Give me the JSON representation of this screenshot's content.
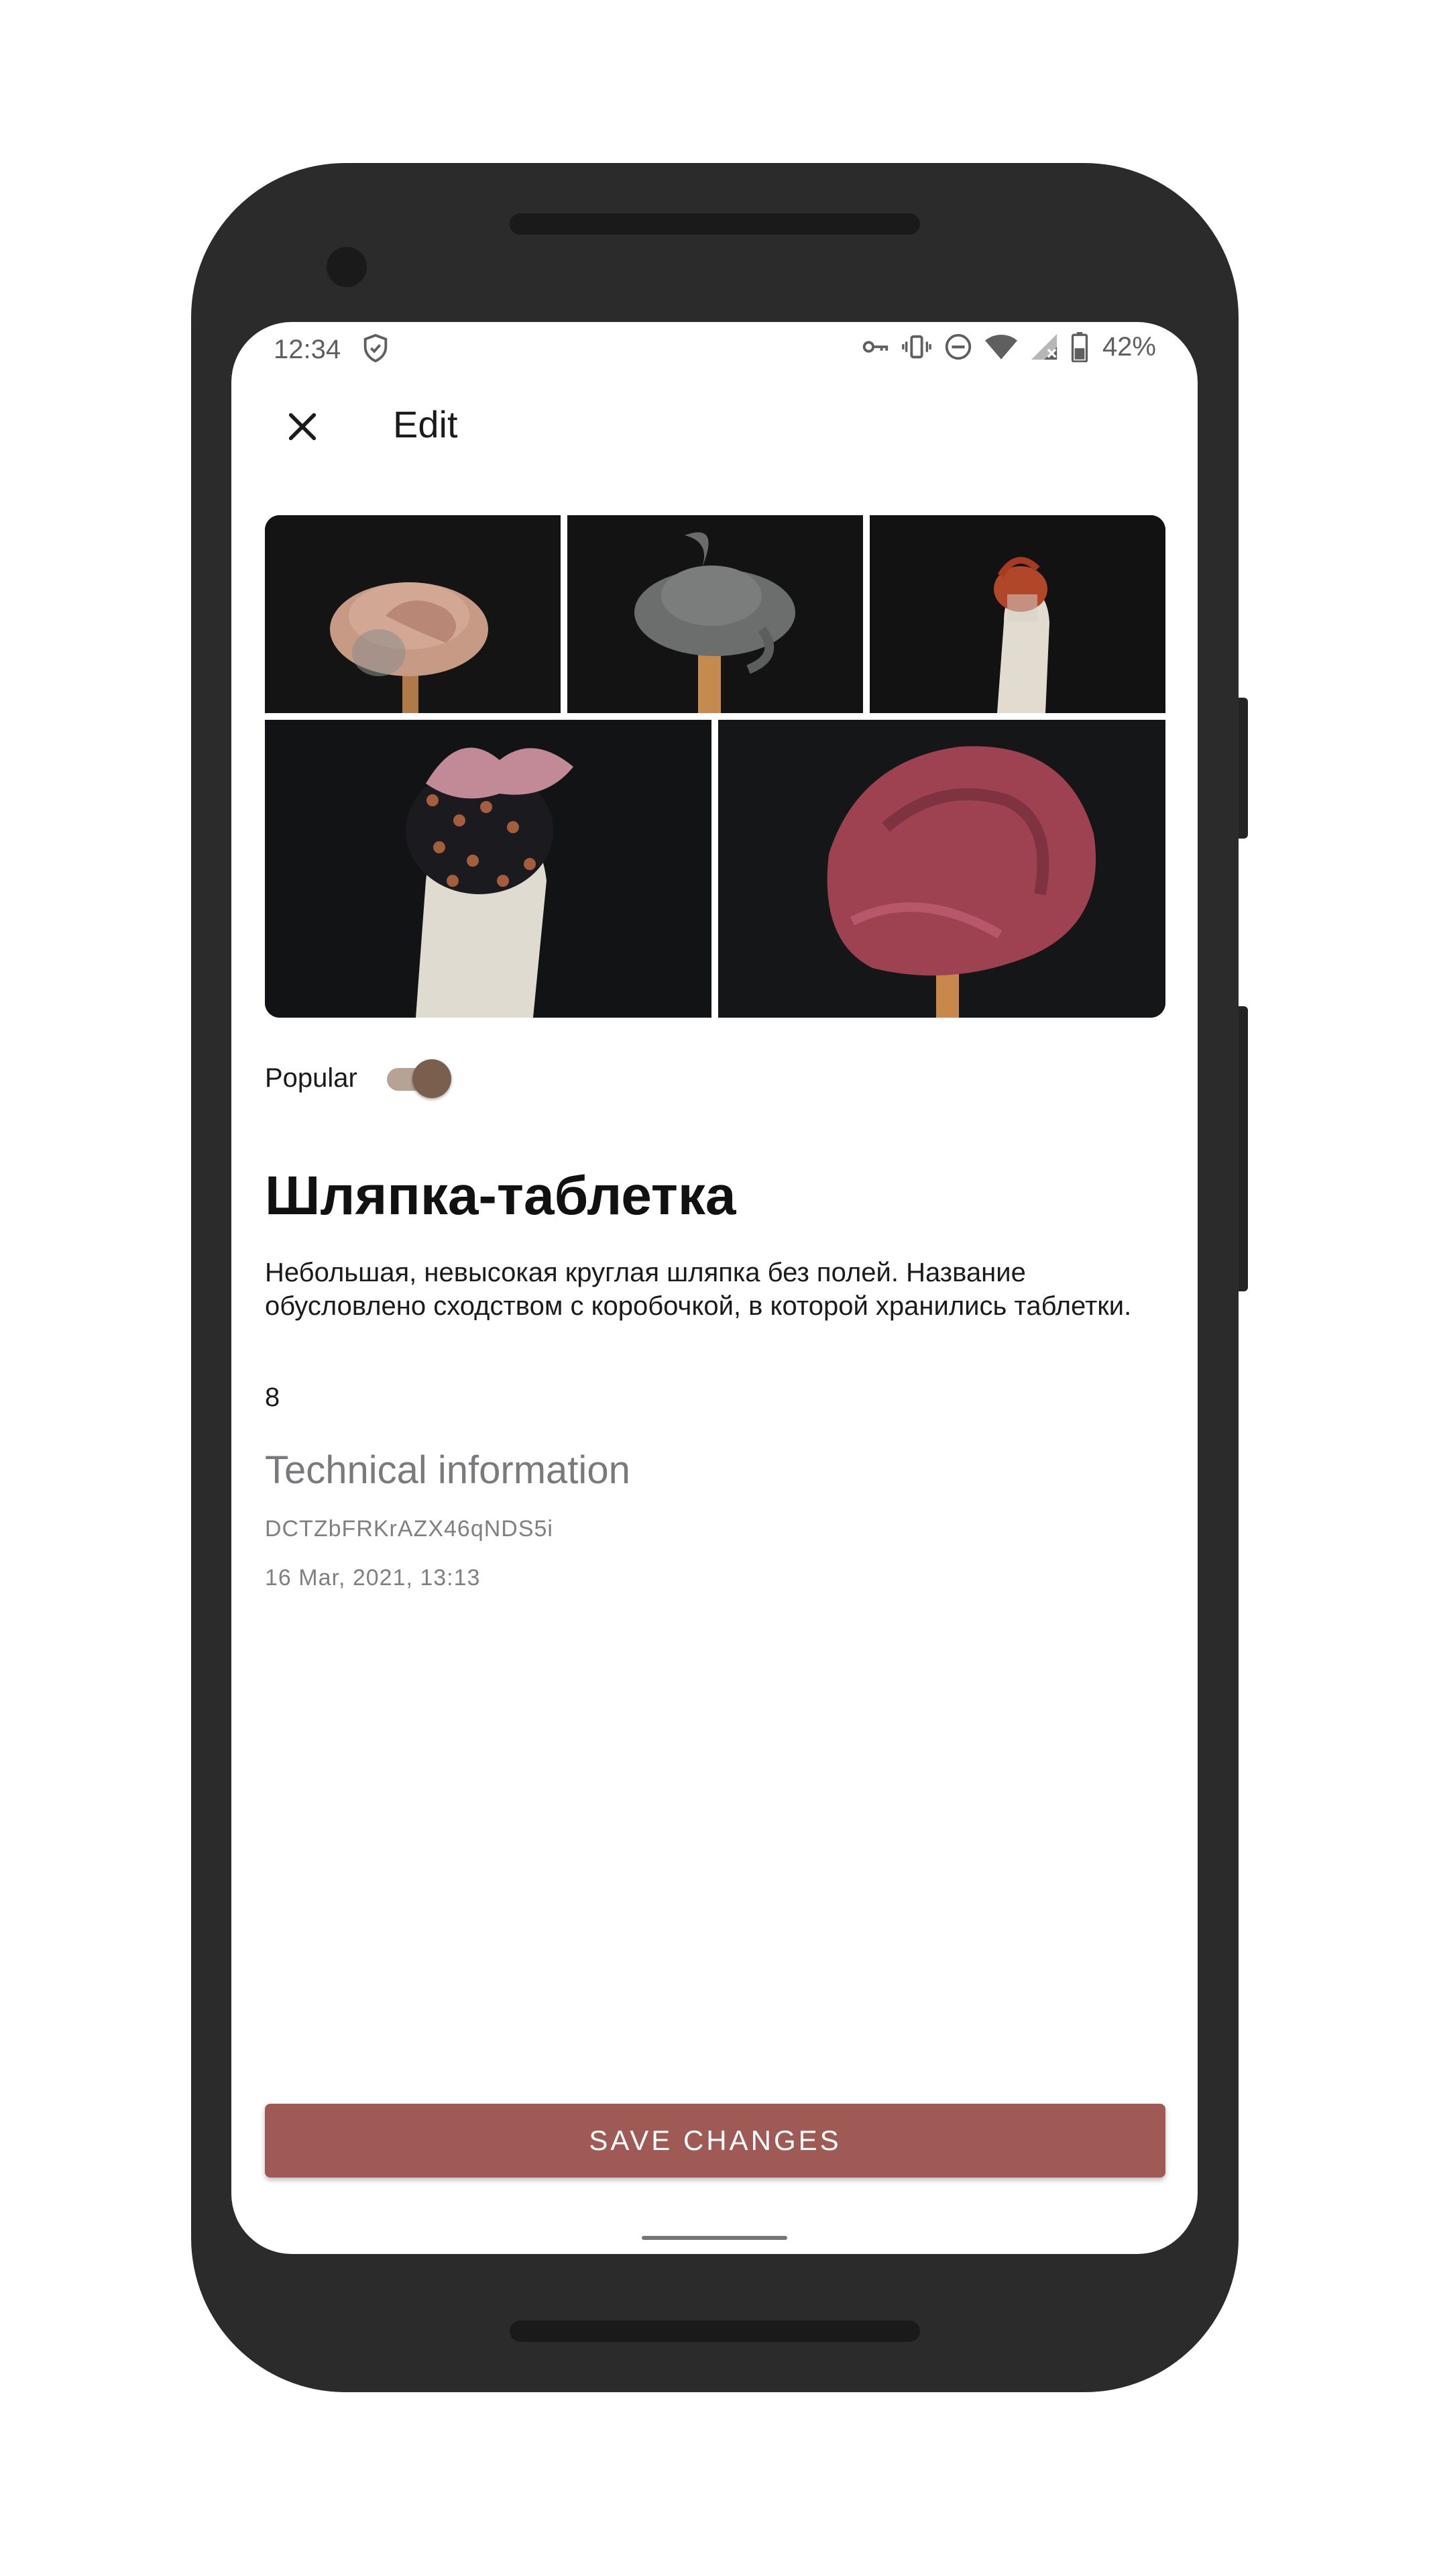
{
  "status_bar": {
    "time": "12:34",
    "battery": "42%",
    "icons": [
      "shield-icon",
      "vpn-key-icon",
      "vibrate-icon",
      "do-not-disturb-icon",
      "wifi-icon",
      "signal-icon",
      "battery-icon"
    ]
  },
  "app_bar": {
    "title": "Edit",
    "close_icon": "close-icon"
  },
  "gallery": {
    "images": [
      "hat-beige-bow-veil",
      "hat-grey-felt",
      "hat-rust-mini-veil",
      "hat-black-pink-bow-beads",
      "hat-burgundy-sculpted"
    ]
  },
  "product": {
    "popular_label": "Popular",
    "popular_on": true,
    "name": "Шляпка-таблетка",
    "description": "Небольшая, невысокая круглая шляпка без полей. Название обусловлено сходством с коробочкой, в которой хранились таблетки.",
    "count": "8"
  },
  "technical": {
    "title": "Technical information",
    "id": "DCTZbFRKrAZX46qNDS5i",
    "date": "16 Mar, 2021, 13:13"
  },
  "actions": {
    "save_label": "SAVE CHANGES"
  },
  "colors": {
    "accent": "#a05a55",
    "toggle_thumb": "#7b5f4e",
    "toggle_track": "#b6a396",
    "phone_body": "#2b2b2b"
  }
}
